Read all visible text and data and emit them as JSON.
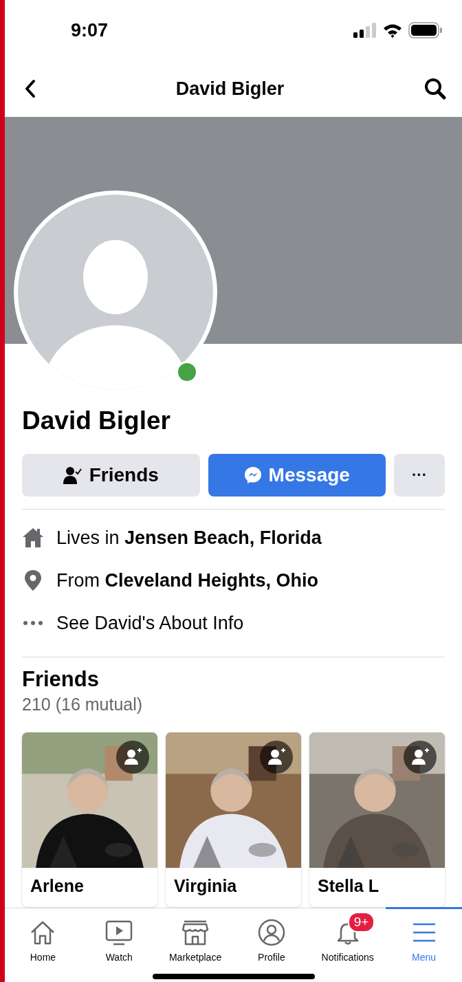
{
  "status_bar": {
    "time": "9:07"
  },
  "nav": {
    "title": "David Bigler"
  },
  "profile": {
    "name": "David Bigler",
    "online": true
  },
  "actions": [
    {
      "kind": "friends",
      "label": "Friends"
    },
    {
      "kind": "message",
      "label": "Message"
    },
    {
      "kind": "more",
      "label": "···"
    }
  ],
  "about": [
    {
      "kind": "home",
      "text": "Lives in **Jensen Beach, Florida**"
    },
    {
      "kind": "pin",
      "text": "From **Cleveland Heights, Ohio**"
    },
    {
      "kind": "more",
      "text": "See David's About Info"
    }
  ],
  "friends": {
    "title": "Friends",
    "count": "210 (16 mutual)",
    "items": [
      {
        "name": "Arlene"
      },
      {
        "name": "Virginia"
      },
      {
        "name": "Stella L"
      }
    ]
  },
  "tab_bar": [
    {
      "kind": "home",
      "label": "Home",
      "selected": false
    },
    {
      "kind": "watch",
      "label": "Watch",
      "selected": false
    },
    {
      "kind": "marketplace",
      "label": "Marketplace",
      "selected": false
    },
    {
      "kind": "profile",
      "label": "Profile",
      "selected": false
    },
    {
      "kind": "notifications",
      "label": "Notifications",
      "selected": false,
      "badge": "9+"
    },
    {
      "kind": "menu",
      "label": "Menu",
      "selected": true
    }
  ]
}
